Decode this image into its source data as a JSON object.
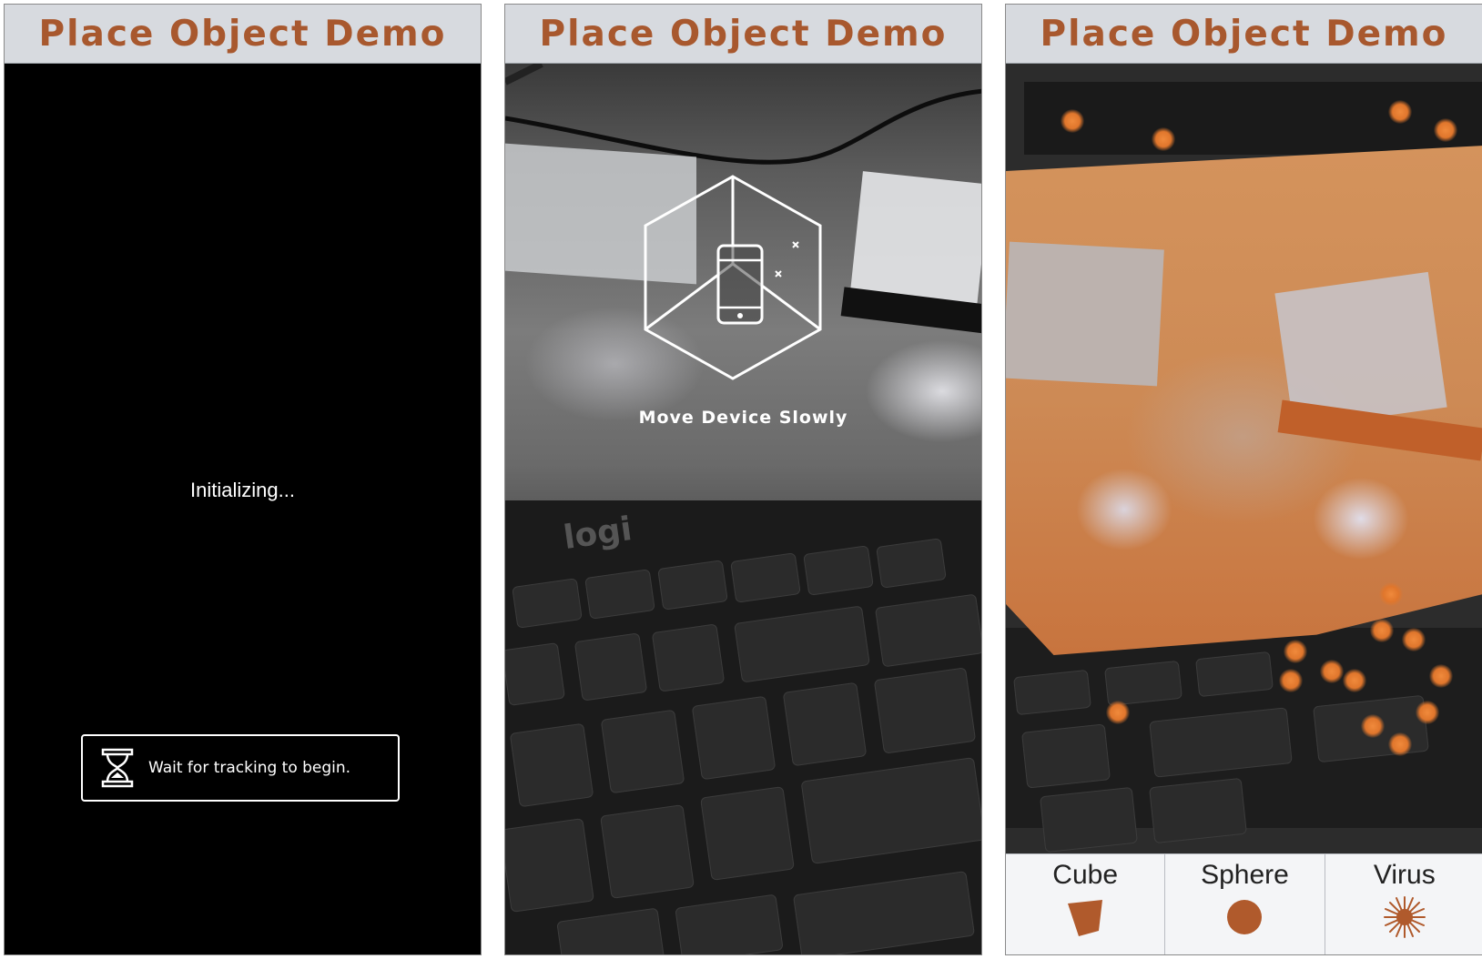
{
  "panels": [
    {
      "title": "Place Object Demo",
      "status_text": "Initializing...",
      "hint": {
        "icon": "hourglass-icon",
        "text": "Wait for tracking to begin."
      }
    },
    {
      "title": "Place Object Demo",
      "overlay": {
        "icon": "move-device-icon",
        "text": "Move Device Slowly"
      },
      "keyboard_brand": "logi"
    },
    {
      "title": "Place Object Demo",
      "object_picker": [
        {
          "label": "Cube",
          "icon": "cube-icon"
        },
        {
          "label": "Sphere",
          "icon": "sphere-icon"
        },
        {
          "label": "Virus",
          "icon": "virus-icon"
        }
      ]
    }
  ],
  "colors": {
    "title_text": "#a8582e",
    "title_bar": "#d7dadf",
    "accent_orange": "#c0602a"
  }
}
